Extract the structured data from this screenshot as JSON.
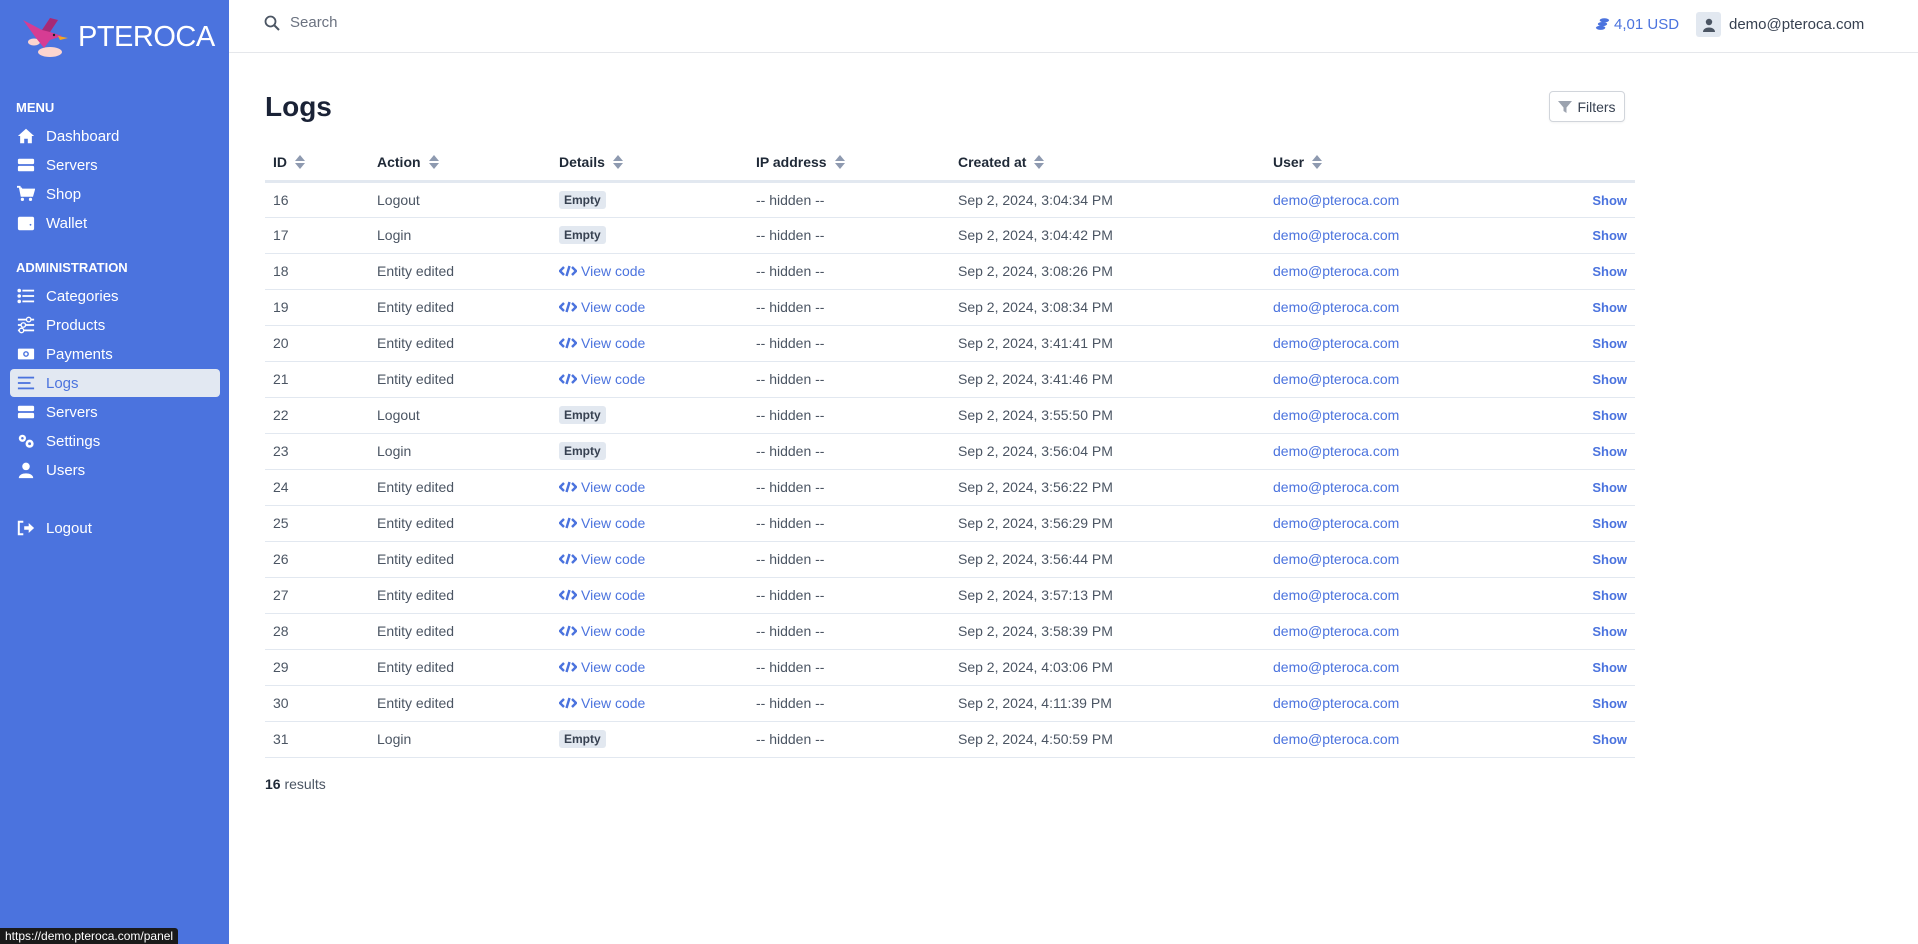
{
  "app": {
    "brand": "PTEROCA"
  },
  "sidebar": {
    "menu_title": "MENU",
    "menu_items": [
      {
        "label": "Dashboard",
        "icon": "home-icon"
      },
      {
        "label": "Servers",
        "icon": "server-icon"
      },
      {
        "label": "Shop",
        "icon": "cart-icon"
      },
      {
        "label": "Wallet",
        "icon": "wallet-icon"
      }
    ],
    "admin_title": "ADMINISTRATION",
    "admin_items": [
      {
        "label": "Categories",
        "icon": "list-icon"
      },
      {
        "label": "Products",
        "icon": "sliders-icon"
      },
      {
        "label": "Payments",
        "icon": "money-icon"
      },
      {
        "label": "Logs",
        "icon": "bars-icon",
        "active": true
      },
      {
        "label": "Servers",
        "icon": "server-icon"
      },
      {
        "label": "Settings",
        "icon": "gears-icon"
      },
      {
        "label": "Users",
        "icon": "user-icon"
      }
    ],
    "logout_label": "Logout"
  },
  "topbar": {
    "search_placeholder": "Search",
    "balance": "4,01 USD",
    "user_email": "demo@pteroca.com"
  },
  "page": {
    "title": "Logs",
    "filters_label": "Filters",
    "results_count": "16",
    "results_label": "results"
  },
  "table": {
    "columns": [
      "ID",
      "Action",
      "Details",
      "IP address",
      "Created at",
      "User"
    ],
    "show_label": "Show",
    "empty_label": "Empty",
    "view_code_label": "View code",
    "rows": [
      {
        "id": "16",
        "action": "Logout",
        "details": "empty",
        "ip": "-- hidden --",
        "created_at": "Sep 2, 2024, 3:04:34 PM",
        "user": "demo@pteroca.com"
      },
      {
        "id": "17",
        "action": "Login",
        "details": "empty",
        "ip": "-- hidden --",
        "created_at": "Sep 2, 2024, 3:04:42 PM",
        "user": "demo@pteroca.com"
      },
      {
        "id": "18",
        "action": "Entity edited",
        "details": "code",
        "ip": "-- hidden --",
        "created_at": "Sep 2, 2024, 3:08:26 PM",
        "user": "demo@pteroca.com"
      },
      {
        "id": "19",
        "action": "Entity edited",
        "details": "code",
        "ip": "-- hidden --",
        "created_at": "Sep 2, 2024, 3:08:34 PM",
        "user": "demo@pteroca.com"
      },
      {
        "id": "20",
        "action": "Entity edited",
        "details": "code",
        "ip": "-- hidden --",
        "created_at": "Sep 2, 2024, 3:41:41 PM",
        "user": "demo@pteroca.com"
      },
      {
        "id": "21",
        "action": "Entity edited",
        "details": "code",
        "ip": "-- hidden --",
        "created_at": "Sep 2, 2024, 3:41:46 PM",
        "user": "demo@pteroca.com"
      },
      {
        "id": "22",
        "action": "Logout",
        "details": "empty",
        "ip": "-- hidden --",
        "created_at": "Sep 2, 2024, 3:55:50 PM",
        "user": "demo@pteroca.com"
      },
      {
        "id": "23",
        "action": "Login",
        "details": "empty",
        "ip": "-- hidden --",
        "created_at": "Sep 2, 2024, 3:56:04 PM",
        "user": "demo@pteroca.com"
      },
      {
        "id": "24",
        "action": "Entity edited",
        "details": "code",
        "ip": "-- hidden --",
        "created_at": "Sep 2, 2024, 3:56:22 PM",
        "user": "demo@pteroca.com"
      },
      {
        "id": "25",
        "action": "Entity edited",
        "details": "code",
        "ip": "-- hidden --",
        "created_at": "Sep 2, 2024, 3:56:29 PM",
        "user": "demo@pteroca.com"
      },
      {
        "id": "26",
        "action": "Entity edited",
        "details": "code",
        "ip": "-- hidden --",
        "created_at": "Sep 2, 2024, 3:56:44 PM",
        "user": "demo@pteroca.com"
      },
      {
        "id": "27",
        "action": "Entity edited",
        "details": "code",
        "ip": "-- hidden --",
        "created_at": "Sep 2, 2024, 3:57:13 PM",
        "user": "demo@pteroca.com"
      },
      {
        "id": "28",
        "action": "Entity edited",
        "details": "code",
        "ip": "-- hidden --",
        "created_at": "Sep 2, 2024, 3:58:39 PM",
        "user": "demo@pteroca.com"
      },
      {
        "id": "29",
        "action": "Entity edited",
        "details": "code",
        "ip": "-- hidden --",
        "created_at": "Sep 2, 2024, 4:03:06 PM",
        "user": "demo@pteroca.com"
      },
      {
        "id": "30",
        "action": "Entity edited",
        "details": "code",
        "ip": "-- hidden --",
        "created_at": "Sep 2, 2024, 4:11:39 PM",
        "user": "demo@pteroca.com"
      },
      {
        "id": "31",
        "action": "Login",
        "details": "empty",
        "ip": "-- hidden --",
        "created_at": "Sep 2, 2024, 4:50:59 PM",
        "user": "demo@pteroca.com"
      }
    ]
  },
  "statusbar": {
    "url": "https://demo.pteroca.com/panel"
  },
  "colors": {
    "sidebar_bg": "#4b73de",
    "accent": "#4b73de",
    "active_item_bg": "#e2e8f2"
  }
}
